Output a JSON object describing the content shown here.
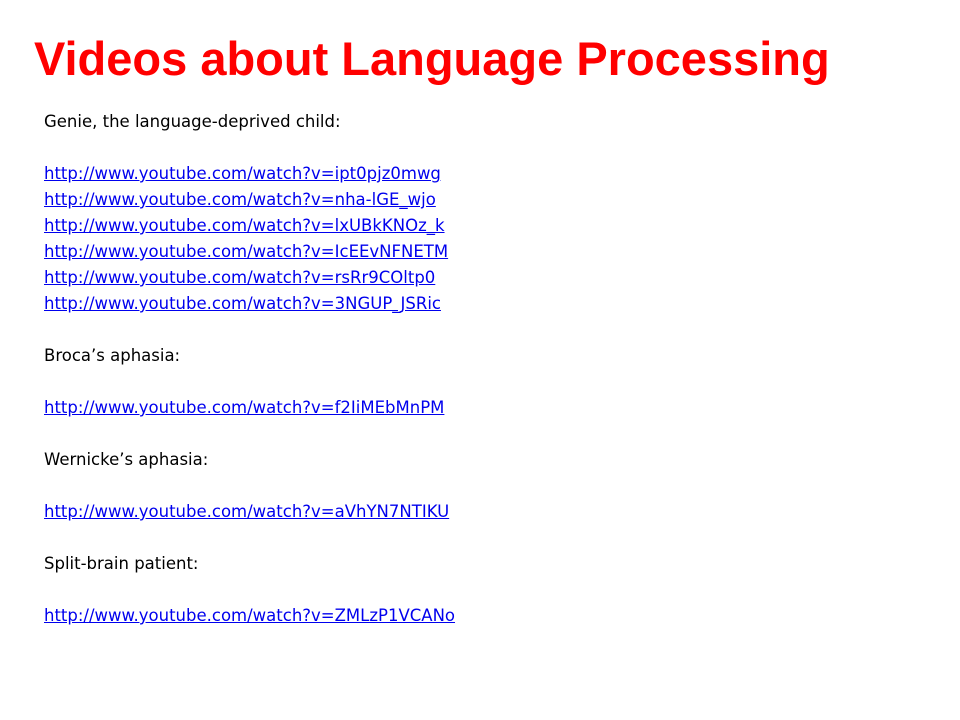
{
  "slide": {
    "title": "Videos about Language Processing",
    "title_color": "#FF0000",
    "link_color": "#0000EE"
  },
  "sections": [
    {
      "heading": "Genie, the language-deprived child:",
      "links": [
        "http://www.youtube.com/watch?v=ipt0pjz0mwg",
        "http://www.youtube.com/watch?v=nha-lGE_wjo",
        "http://www.youtube.com/watch?v=lxUBkKNOz_k",
        "http://www.youtube.com/watch?v=IcEEvNFNETM",
        "http://www.youtube.com/watch?v=rsRr9COltp0",
        "http://www.youtube.com/watch?v=3NGUP_JSRic"
      ]
    },
    {
      "heading": "Broca’s aphasia:",
      "links": [
        "http://www.youtube.com/watch?v=f2IiMEbMnPM"
      ]
    },
    {
      "heading": "Wernicke’s aphasia:",
      "links": [
        "http://www.youtube.com/watch?v=aVhYN7NTIKU"
      ]
    },
    {
      "heading": "Split-brain patient:",
      "links": [
        "http://www.youtube.com/watch?v=ZMLzP1VCANo"
      ]
    }
  ]
}
